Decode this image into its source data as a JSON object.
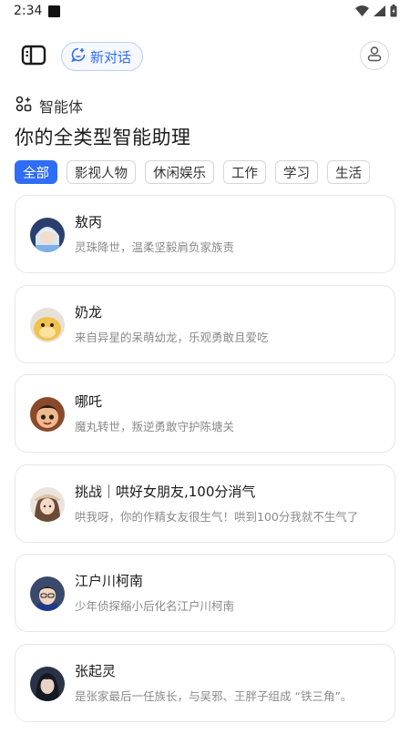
{
  "status_bar": {
    "time": "2:34"
  },
  "top_bar": {
    "new_chat_label": "新对话"
  },
  "section": {
    "label": "智能体",
    "title": "你的全类型智能助理"
  },
  "filters": [
    {
      "label": "全部",
      "active": true
    },
    {
      "label": "影视人物",
      "active": false
    },
    {
      "label": "休闲娱乐",
      "active": false
    },
    {
      "label": "工作",
      "active": false
    },
    {
      "label": "学习",
      "active": false
    },
    {
      "label": "生活",
      "active": false
    }
  ],
  "agents": [
    {
      "name": "敖丙",
      "description": "灵珠降世，温柔坚毅肩负家族责"
    },
    {
      "name": "奶龙",
      "description": "来自异星的呆萌幼龙，乐观勇敢且爱吃"
    },
    {
      "name": "哪吒",
      "description": "魔丸转世，叛逆勇敢守护陈塘关"
    },
    {
      "name": "挑战｜哄好女朋友,100分消气",
      "description": "哄我呀，你的作精女友很生气！哄到100分我就不生气了"
    },
    {
      "name": "江户川柯南",
      "description": "少年侦探缩小后化名江户川柯南"
    },
    {
      "name": "张起灵",
      "description": "是张家最后一任族长，与吴邪、王胖子组成 “铁三角”。"
    }
  ],
  "colors": {
    "accent": "#2f6df6",
    "chip_border": "#d6d6d6",
    "card_border": "#e6e6e6"
  }
}
